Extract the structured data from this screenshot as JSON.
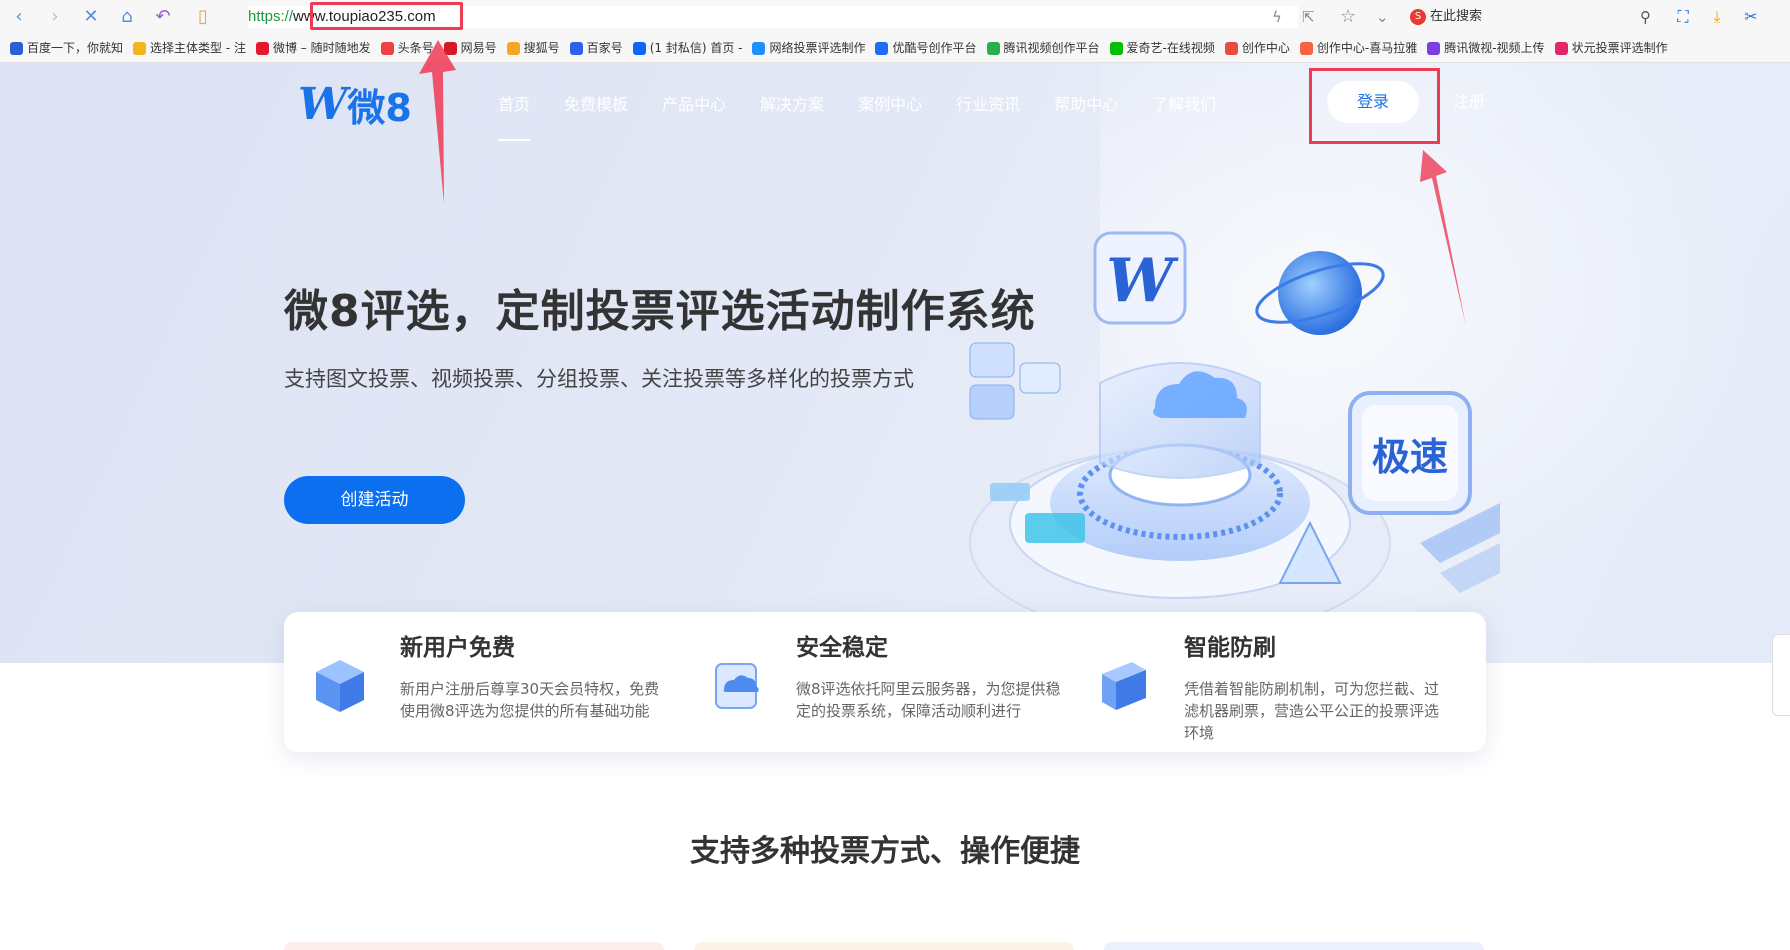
{
  "browser": {
    "url_protocol": "https://",
    "url_host": "www.toupiao235.com",
    "search_placeholder": "在此搜索"
  },
  "bookmarks": [
    {
      "label": "百度一下，你就知",
      "color": "#2b5ed1"
    },
    {
      "label": "选择主体类型 - 注",
      "color": "#f2b51b"
    },
    {
      "label": "微博 – 随时随地发",
      "color": "#e6162d"
    },
    {
      "label": "头条号",
      "color": "#f04142"
    },
    {
      "label": "网易号",
      "color": "#d51a26"
    },
    {
      "label": "搜狐号",
      "color": "#f5a623"
    },
    {
      "label": "百家号",
      "color": "#2d63e8"
    },
    {
      "label": "(1 封私信) 首页 -",
      "color": "#0b66ff"
    },
    {
      "label": "网络投票评选制作",
      "color": "#1e90ff"
    },
    {
      "label": "优酷号创作平台",
      "color": "#1f6cf7"
    },
    {
      "label": "腾讯视频创作平台",
      "color": "#28b04a"
    },
    {
      "label": "爱奇艺-在线视频",
      "color": "#00be06"
    },
    {
      "label": "创作中心",
      "color": "#e74d3c"
    },
    {
      "label": "创作中心-喜马拉雅",
      "color": "#f86442"
    },
    {
      "label": "腾讯微视-视频上传",
      "color": "#7b3fe4"
    },
    {
      "label": "状元投票评选制作",
      "color": "#e2266b"
    }
  ],
  "site": {
    "logo_text": "微8",
    "nav": [
      "首页",
      "免费模板",
      "产品中心",
      "解决方案",
      "案例中心",
      "行业资讯",
      "帮助中心",
      "了解我们"
    ],
    "login_label": "登录",
    "register_label": "注册"
  },
  "hero": {
    "title": "微8评选，定制投票评选活动制作系统",
    "subtitle": "支持图文投票、视频投票、分组投票、关注投票等多样化的投票方式",
    "cta_label": "创建活动",
    "badge_text": "极速"
  },
  "features": [
    {
      "title": "新用户免费",
      "desc": "新用户注册后尊享30天会员特权，免费使用微8评选为您提供的所有基础功能"
    },
    {
      "title": "安全稳定",
      "desc": "微8评选依托阿里云服务器，为您提供稳定的投票系统，保障活动顺利进行"
    },
    {
      "title": "智能防刷",
      "desc": "凭借着智能防刷机制，可为您拦截、过滤机器刷票，营造公平公正的投票评选环境"
    }
  ],
  "section_title": "支持多种投票方式、操作便捷",
  "colors": {
    "brand_blue": "#0b6ff0",
    "annotation_red": "#ee3b54"
  }
}
